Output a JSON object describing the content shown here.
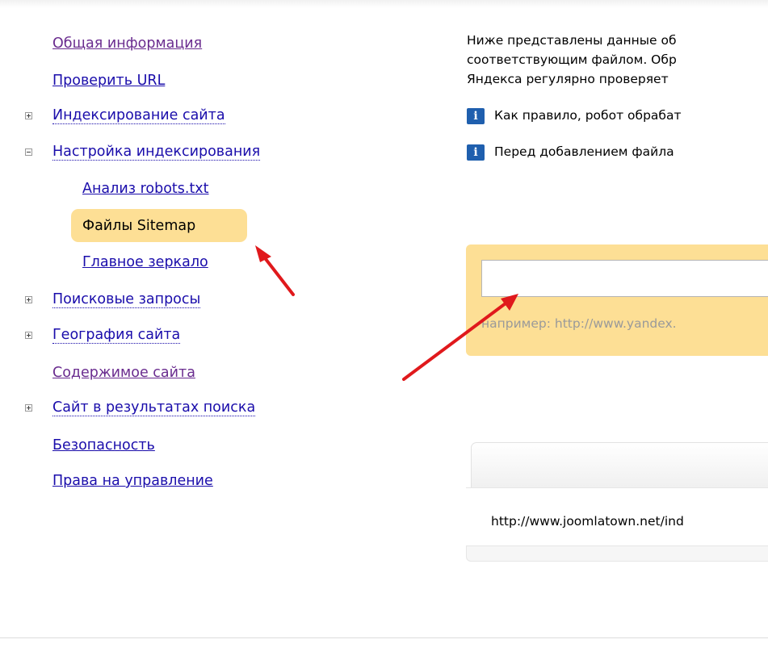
{
  "sidebar": {
    "items": [
      {
        "label": "Общая информация"
      },
      {
        "label": "Проверить URL"
      },
      {
        "label": "Индексирование сайта"
      },
      {
        "label": "Настройка индексирования"
      },
      {
        "label": "Анализ robots.txt"
      },
      {
        "label": "Файлы Sitemap"
      },
      {
        "label": "Главное зеркало"
      },
      {
        "label": "Поисковые запросы"
      },
      {
        "label": "География сайта"
      },
      {
        "label": "Содержимое сайта"
      },
      {
        "label": "Сайт в результатах поиска"
      },
      {
        "label": "Безопасность"
      },
      {
        "label": "Права на управление"
      }
    ],
    "selected": "Файлы Sitemap"
  },
  "main": {
    "description_lines": [
      "Ниже представлены данные об",
      "соответствующим файлом. Обр",
      "Яндекса регулярно проверяет"
    ],
    "tips": [
      "Как правило, робот обрабат",
      "Перед добавлением файла"
    ],
    "info_icon_glyph": "i",
    "url_input": {
      "value": "",
      "placeholder": ""
    },
    "example_text": "например: http://www.yandex.",
    "table_rows": [
      {
        "url": "http://www.joomlatown.net/ind"
      }
    ]
  },
  "colors": {
    "link": "#1a0dab",
    "visited_link": "#6a2c8f",
    "highlight": "#fddf95",
    "info_icon": "#1f5fae",
    "arrow": "#e0191c"
  },
  "icons": [
    "plus-toggle-icon",
    "minus-toggle-icon",
    "info-icon",
    "red-arrow-annotation"
  ]
}
